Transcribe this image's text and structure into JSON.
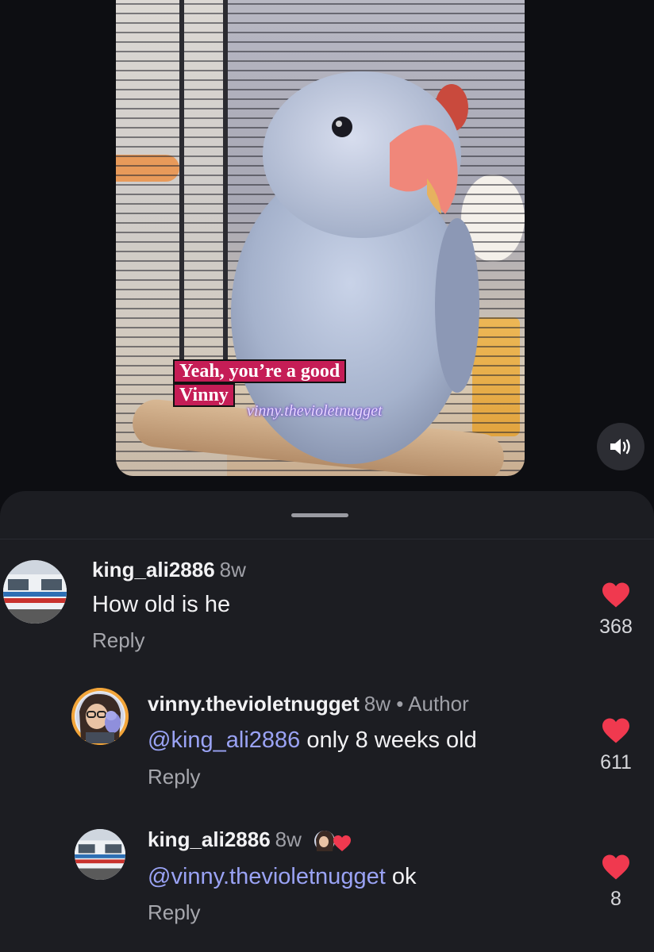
{
  "video": {
    "caption_line1": "Yeah, you’re a good",
    "caption_line2": "Vinny",
    "watermark": "vinny.thevioletnugget",
    "volume_icon": "speaker-on-icon"
  },
  "comments": [
    {
      "username": "king_ali2886",
      "age": "8w",
      "text": "How old is he",
      "reply_label": "Reply",
      "likes": "368",
      "avatar_icon": "train-avatar"
    },
    {
      "username": "vinny.thevioletnugget",
      "age": "8w",
      "separator": "•",
      "badge": "Author",
      "mention": "@king_ali2886",
      "text": " only 8 weeks old",
      "reply_label": "Reply",
      "likes": "611",
      "avatar_icon": "cartoon-girl-with-parrot-avatar"
    },
    {
      "username": "king_ali2886",
      "age": "8w",
      "mention": "@vinny.thevioletnugget",
      "text": " ok",
      "reply_label": "Reply",
      "likes": "8",
      "avatar_icon": "train-avatar",
      "creator_liked_icon": "author-liked-heart-icon"
    }
  ],
  "colors": {
    "background": "#0d0e12",
    "sheet": "#1c1d22",
    "like_red": "#f0394f",
    "mention": "#9aa3f5",
    "caption_pink": "#c51d56"
  }
}
